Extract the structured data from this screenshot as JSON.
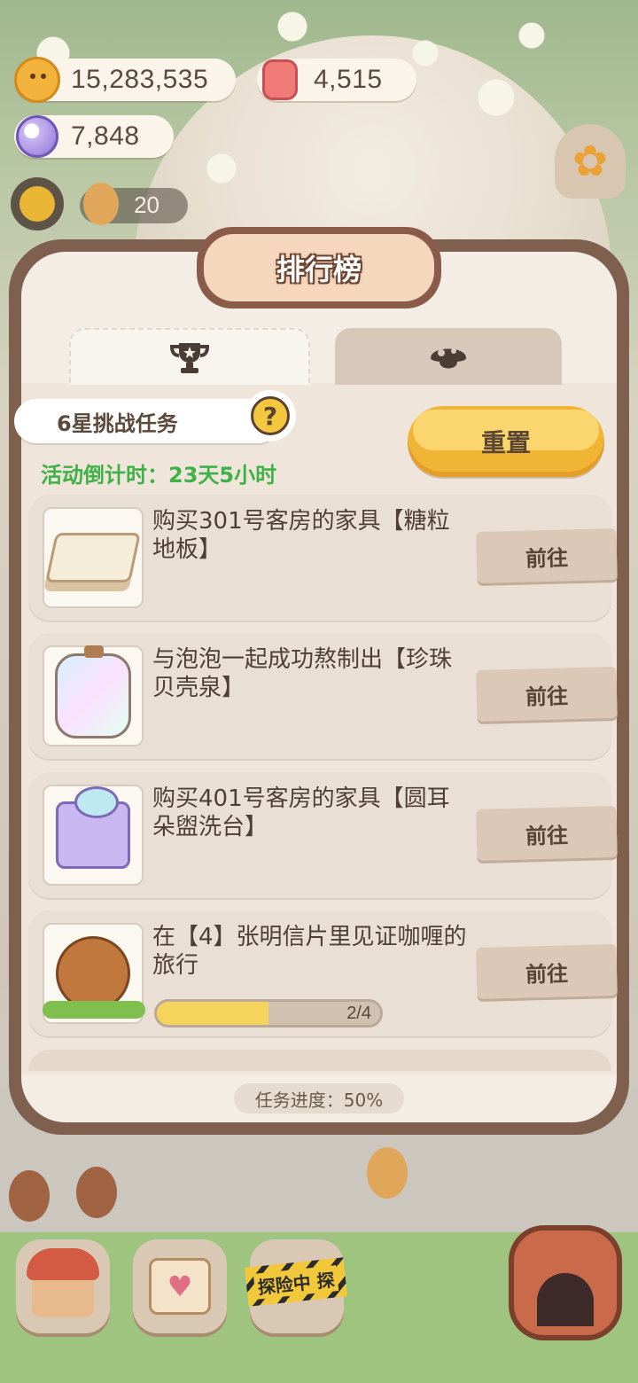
{
  "currency": {
    "coins": "15,283,535",
    "gems": "4,515",
    "crystals": "7,848"
  },
  "hud": {
    "counter": "20"
  },
  "panel": {
    "title": "排行榜",
    "tabs": [
      {
        "icon": "trophy-icon",
        "active": true
      },
      {
        "icon": "mushroom-icon",
        "active": false
      }
    ],
    "challenge_label": "6星挑战任务",
    "help_symbol": "?",
    "countdown": "活动倒计时：23天5小时",
    "reset_label": "重置",
    "tasks": [
      {
        "text": "购买301号客房的家具【糖粒地板】",
        "button": "前往",
        "thumb": "sugar-floor-tile"
      },
      {
        "text": "与泡泡一起成功熬制出【珍珠贝壳泉】",
        "button": "前往",
        "thumb": "pearl-shell-fountain"
      },
      {
        "text": "购买401号客房的家具【圆耳朵盥洗台】",
        "button": "前往",
        "thumb": "round-ear-washstand"
      },
      {
        "text": "在【4】张明信片里见证咖喱的旅行",
        "button": "前往",
        "thumb": "curry-cookie",
        "progress_text": "2/4",
        "progress_fraction": 0.5
      }
    ],
    "progress_summary": "任务进度：50%"
  },
  "bottom_nav": {
    "explore_label": "探险中 探"
  },
  "colors": {
    "panel_border": "#7f5f4d",
    "reset_button": "#f1b535",
    "countdown_green": "#3fb247",
    "progress_fill": "#f5d45d"
  }
}
